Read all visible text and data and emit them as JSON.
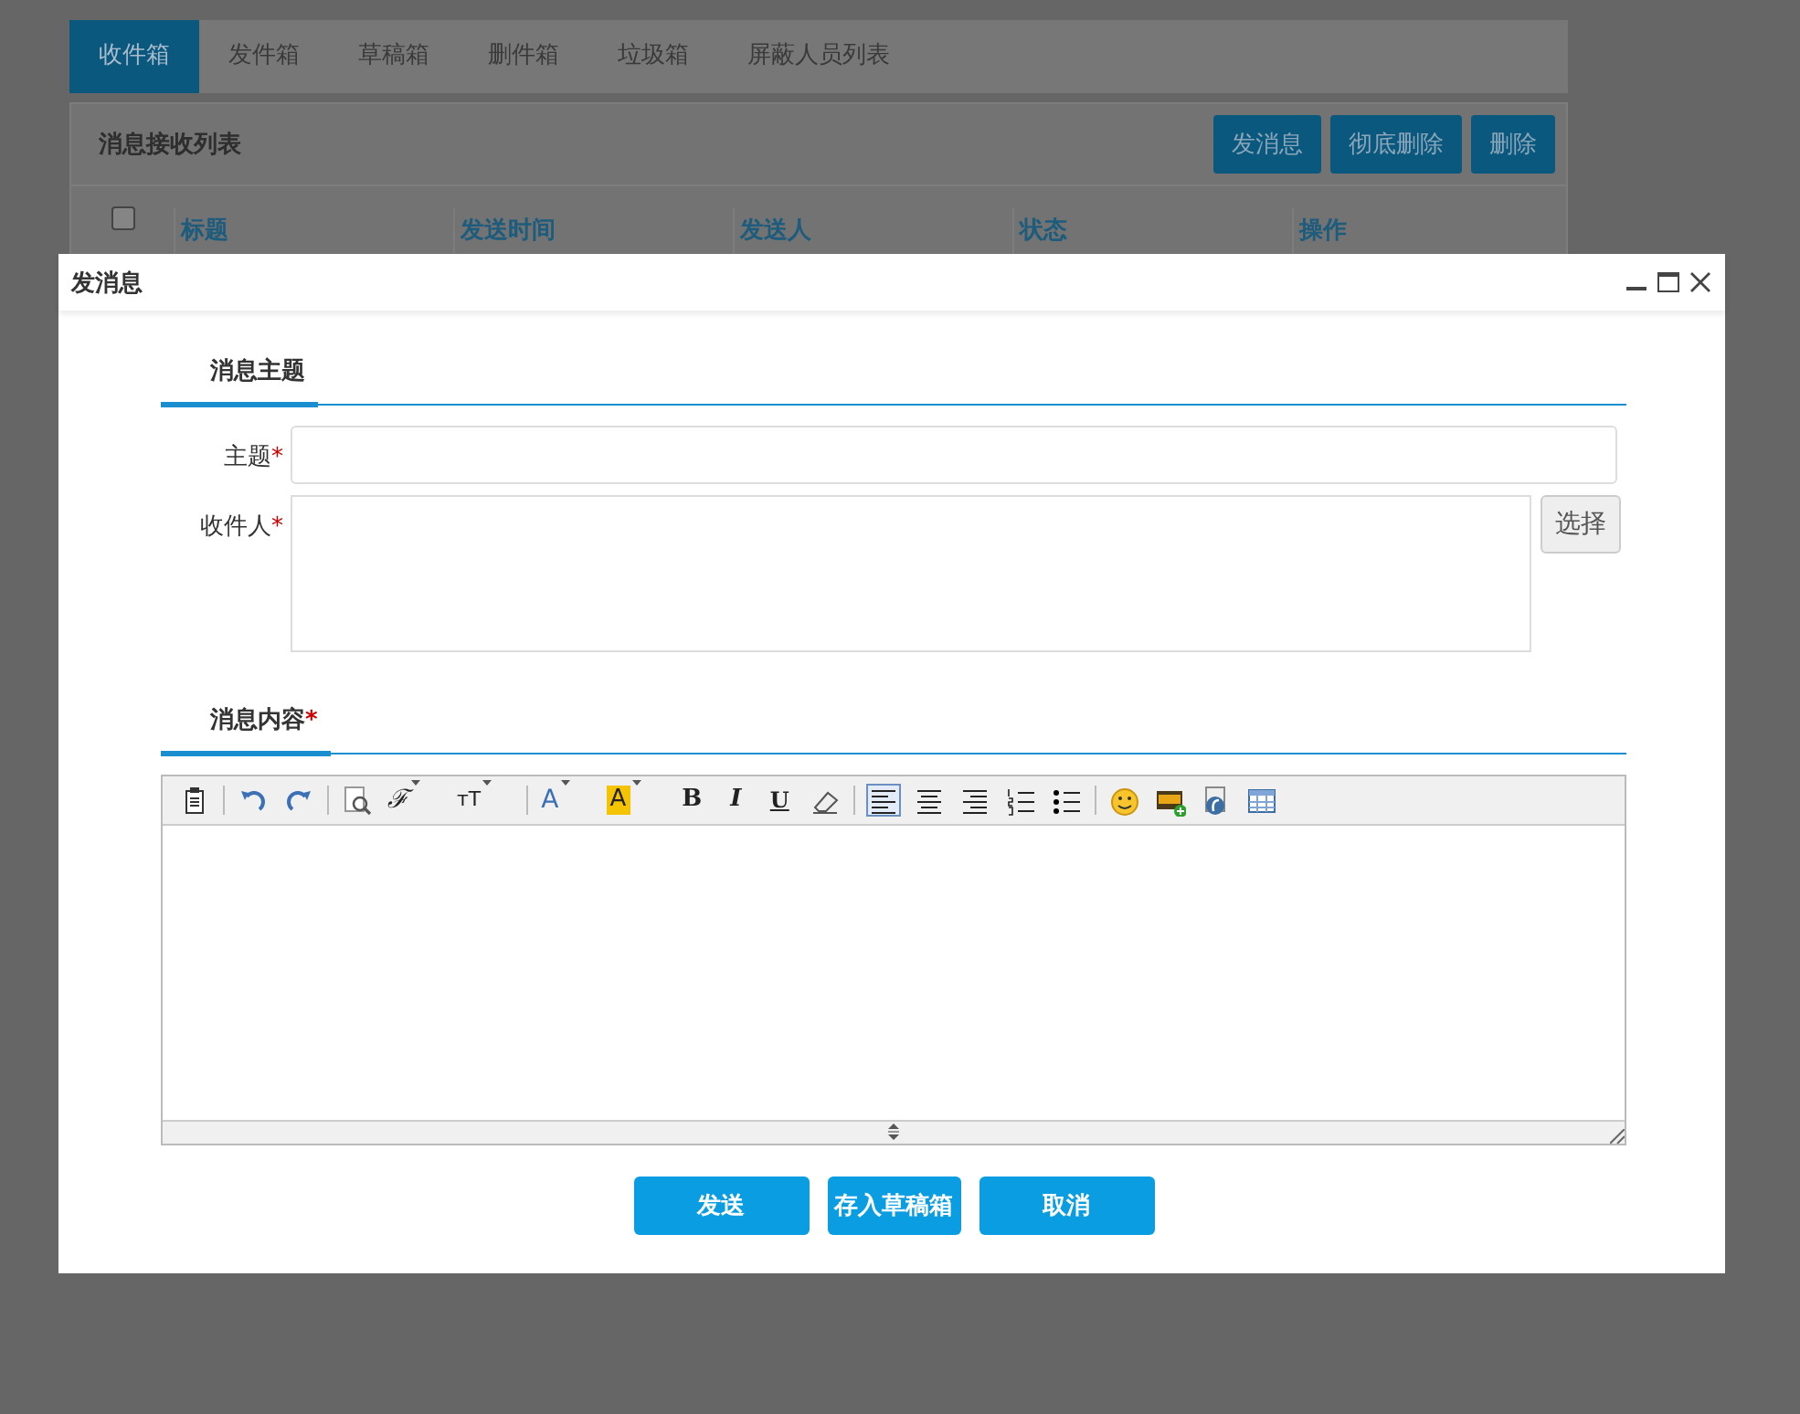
{
  "tabs": [
    {
      "label": "收件箱",
      "selected": true
    },
    {
      "label": "发件箱",
      "selected": false
    },
    {
      "label": "草稿箱",
      "selected": false
    },
    {
      "label": "删件箱",
      "selected": false
    },
    {
      "label": "垃圾箱",
      "selected": false
    },
    {
      "label": "屏蔽人员列表",
      "selected": false
    }
  ],
  "list_panel": {
    "title": "消息接收列表",
    "actions": [
      "发消息",
      "彻底删除",
      "删除"
    ],
    "select_all": {
      "checked": false
    },
    "columns": [
      "标题",
      "发送时间",
      "发送人",
      "状态",
      "操作"
    ]
  },
  "dialog": {
    "title": "发消息",
    "subject_section": {
      "heading": "消息主题"
    },
    "fields": [
      {
        "kind": "input",
        "label": "主题",
        "required_mark": "*"
      },
      {
        "kind": "textarea",
        "label": "收件人",
        "required_mark": "*",
        "button": "选择"
      }
    ],
    "content_section": {
      "heading": "消息内容",
      "required_mark": "*"
    },
    "toolbar": [
      [
        {
          "kind": "paste"
        }
      ],
      [
        {
          "kind": "undo"
        },
        {
          "kind": "redo"
        }
      ],
      [
        {
          "kind": "preview"
        },
        {
          "kind": "font",
          "glyph": "ℱ"
        },
        {
          "kind": "size",
          "glyph": "тT"
        }
      ],
      [
        {
          "kind": "color",
          "glyph": "A"
        },
        {
          "kind": "highlight",
          "glyph": "A"
        },
        {
          "kind": "bold",
          "glyph": "B"
        },
        {
          "kind": "italic",
          "glyph": "I"
        },
        {
          "kind": "underline",
          "glyph": "U"
        },
        {
          "kind": "eraser"
        }
      ],
      [
        {
          "kind": "align-left",
          "selected": true
        },
        {
          "kind": "align-center",
          "selected": false
        },
        {
          "kind": "align-right",
          "selected": false
        },
        {
          "kind": "ordered-list"
        },
        {
          "kind": "bullet-list"
        }
      ],
      [
        {
          "kind": "emoji"
        },
        {
          "kind": "image"
        },
        {
          "kind": "flash"
        },
        {
          "kind": "table"
        }
      ]
    ],
    "buttons": [
      "发送",
      "存入草稿箱",
      "取消"
    ]
  }
}
